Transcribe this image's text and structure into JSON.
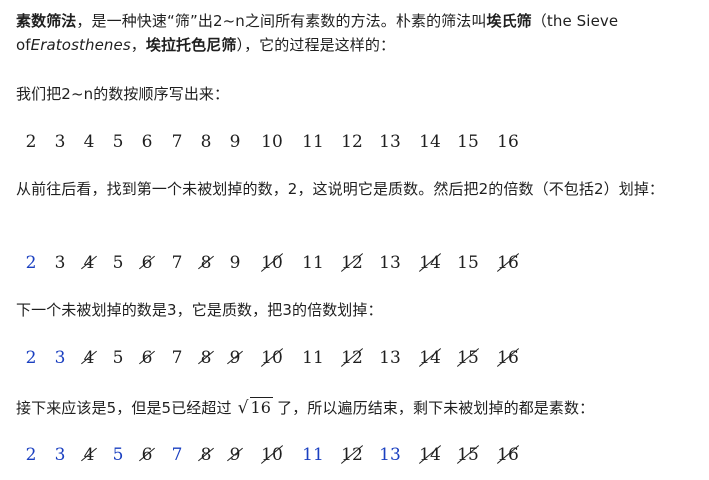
{
  "intro": {
    "term": "素数筛法",
    "text1": "，是一种快速“筛”出2~n之间所有素数的方法。朴素的筛法叫",
    "name_cn": "埃氏筛",
    "paren_open": "（the Sieve of",
    "name_en": "Eratosthenes",
    "comma": "，",
    "name_alt": "埃拉托色尼筛",
    "text2": "），它的过程是这样的："
  },
  "step1": {
    "text": "我们把2~n的数按顺序写出来："
  },
  "step2": {
    "text": "从前往后看，找到第一个未被划掉的数，2，这说明它是质数。然后把2的倍数（不包括2）划掉："
  },
  "step3": {
    "text": "下一个未被划掉的数是3，它是质数，把3的倍数划掉："
  },
  "step4": {
    "text_before": "接下来应该是5，但是5已经超过",
    "sqrt_symbol": "√",
    "sqrt_value": "16",
    "text_after": "了，所以遍历结束，剩下未被划掉的都是素数："
  },
  "sequences": [
    {
      "items": [
        {
          "value": "2",
          "state": "plain"
        },
        {
          "value": "3",
          "state": "plain"
        },
        {
          "value": "4",
          "state": "plain"
        },
        {
          "value": "5",
          "state": "plain"
        },
        {
          "value": "6",
          "state": "plain"
        },
        {
          "value": "7",
          "state": "plain"
        },
        {
          "value": "8",
          "state": "plain"
        },
        {
          "value": "9",
          "state": "plain"
        },
        {
          "value": "10",
          "state": "plain"
        },
        {
          "value": "11",
          "state": "plain"
        },
        {
          "value": "12",
          "state": "plain"
        },
        {
          "value": "13",
          "state": "plain"
        },
        {
          "value": "14",
          "state": "plain"
        },
        {
          "value": "15",
          "state": "plain"
        },
        {
          "value": "16",
          "state": "plain"
        }
      ]
    },
    {
      "items": [
        {
          "value": "2",
          "state": "prime"
        },
        {
          "value": "3",
          "state": "plain"
        },
        {
          "value": "4",
          "state": "struck"
        },
        {
          "value": "5",
          "state": "plain"
        },
        {
          "value": "6",
          "state": "struck"
        },
        {
          "value": "7",
          "state": "plain"
        },
        {
          "value": "8",
          "state": "struck"
        },
        {
          "value": "9",
          "state": "plain"
        },
        {
          "value": "10",
          "state": "struck"
        },
        {
          "value": "11",
          "state": "plain"
        },
        {
          "value": "12",
          "state": "struck"
        },
        {
          "value": "13",
          "state": "plain"
        },
        {
          "value": "14",
          "state": "struck"
        },
        {
          "value": "15",
          "state": "plain"
        },
        {
          "value": "16",
          "state": "struck"
        }
      ]
    },
    {
      "items": [
        {
          "value": "2",
          "state": "prime"
        },
        {
          "value": "3",
          "state": "prime"
        },
        {
          "value": "4",
          "state": "struck"
        },
        {
          "value": "5",
          "state": "plain"
        },
        {
          "value": "6",
          "state": "struck"
        },
        {
          "value": "7",
          "state": "plain"
        },
        {
          "value": "8",
          "state": "struck"
        },
        {
          "value": "9",
          "state": "struck"
        },
        {
          "value": "10",
          "state": "struck"
        },
        {
          "value": "11",
          "state": "plain"
        },
        {
          "value": "12",
          "state": "struck"
        },
        {
          "value": "13",
          "state": "plain"
        },
        {
          "value": "14",
          "state": "struck"
        },
        {
          "value": "15",
          "state": "struck"
        },
        {
          "value": "16",
          "state": "struck"
        }
      ]
    },
    {
      "items": [
        {
          "value": "2",
          "state": "prime"
        },
        {
          "value": "3",
          "state": "prime"
        },
        {
          "value": "4",
          "state": "struck"
        },
        {
          "value": "5",
          "state": "prime"
        },
        {
          "value": "6",
          "state": "struck"
        },
        {
          "value": "7",
          "state": "prime"
        },
        {
          "value": "8",
          "state": "struck"
        },
        {
          "value": "9",
          "state": "struck"
        },
        {
          "value": "10",
          "state": "struck"
        },
        {
          "value": "11",
          "state": "prime"
        },
        {
          "value": "12",
          "state": "struck"
        },
        {
          "value": "13",
          "state": "prime"
        },
        {
          "value": "14",
          "state": "struck"
        },
        {
          "value": "15",
          "state": "struck"
        },
        {
          "value": "16",
          "state": "struck"
        }
      ]
    }
  ],
  "colors": {
    "prime": "#1a3fc0",
    "text": "#1f1f1f",
    "background": "#ffffff"
  }
}
